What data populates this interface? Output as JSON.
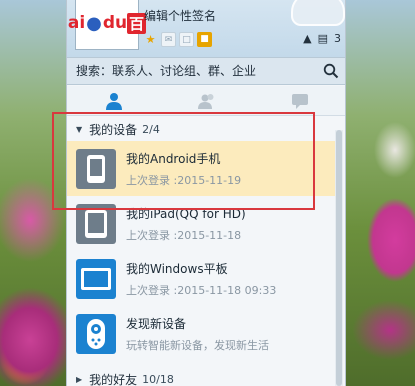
{
  "profile": {
    "signature": "编辑个性签名",
    "avatar_logo": {
      "part1": "ai",
      "part2": "du",
      "part3": "百"
    },
    "message_count": "3"
  },
  "search": {
    "placeholder": "搜索：联系人、讨论组、群、企业"
  },
  "groups": {
    "devices": {
      "label": "我的设备",
      "count": "2/4"
    },
    "friends": {
      "label": "我的好友",
      "count": "10/18"
    }
  },
  "devices": [
    {
      "name": "我的Android手机",
      "subtitle": "上次登录 :2015-11-19",
      "icon": "phone-icon"
    },
    {
      "name": "我的iPad(QQ for HD)",
      "subtitle": "上次登录 :2015-11-18",
      "icon": "tablet-icon"
    },
    {
      "name": "我的Windows平板",
      "subtitle": "上次登录 :2015-11-18 09:33",
      "icon": "windows-tablet-icon"
    },
    {
      "name": "发现新设备",
      "subtitle": "玩转智能新设备，发现新生活",
      "icon": "remote-icon"
    }
  ],
  "colors": {
    "accent_blue": "#1b82d0",
    "selected_bg": "#fcebbd",
    "highlight_border": "#d9383e"
  }
}
